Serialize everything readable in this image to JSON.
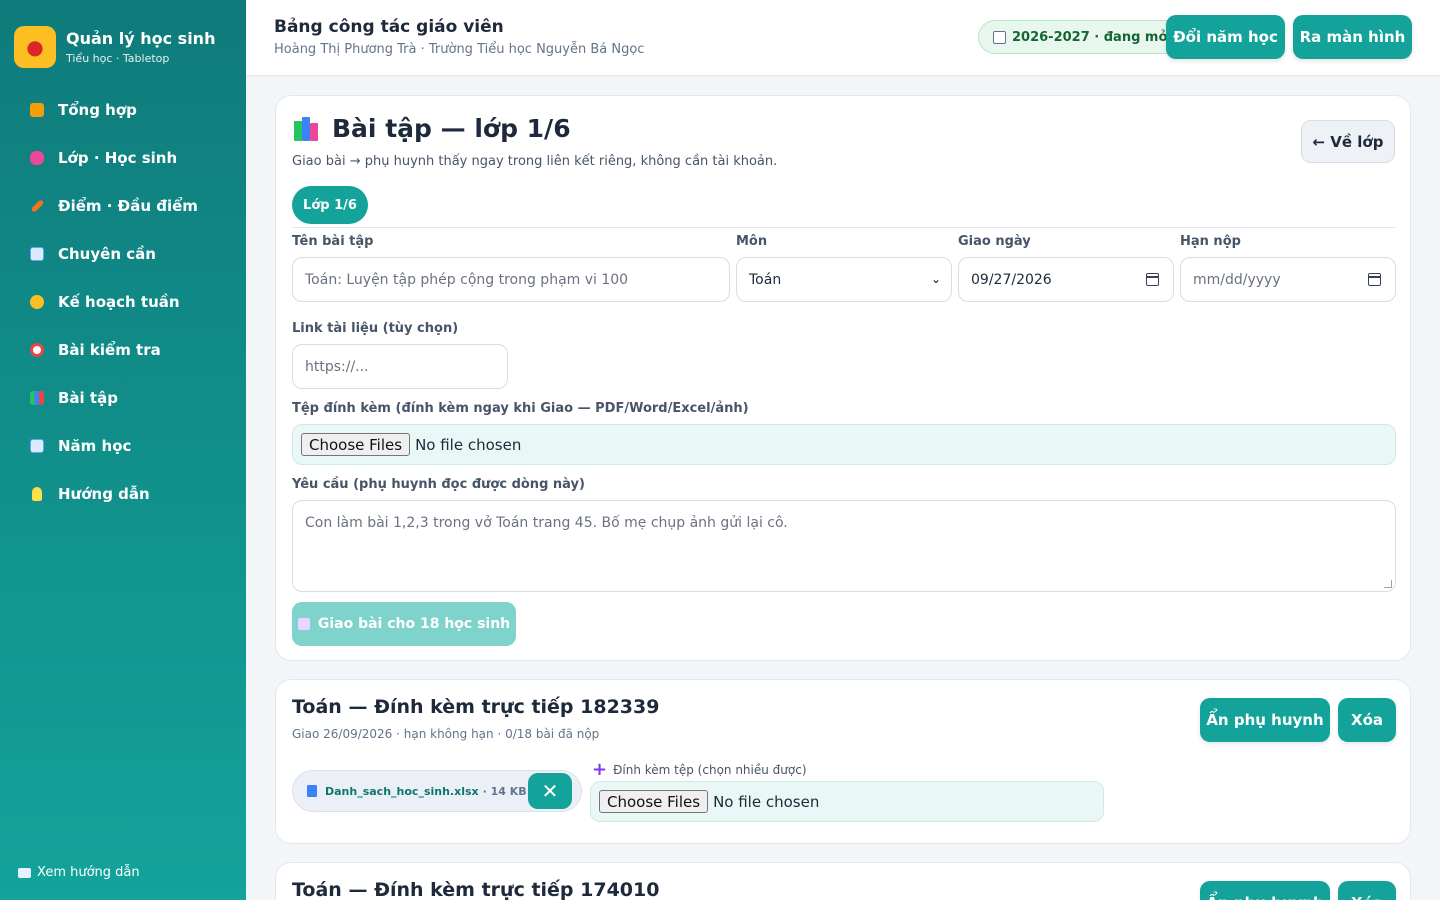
{
  "app": {
    "title": "Quản lý học sinh",
    "subtitle": "Tiểu học · Tabletop"
  },
  "sidebar": {
    "items": [
      {
        "label": "Tổng hợp",
        "icon": "house-icon",
        "color": "#f59e0b"
      },
      {
        "label": "Lớp · Học sinh",
        "icon": "backpack-icon",
        "color": "#ec4899"
      },
      {
        "label": "Điểm · Đầu điểm",
        "icon": "pencil-icon",
        "color": "#f97316"
      },
      {
        "label": "Chuyên cần",
        "icon": "calendar-icon",
        "color": "#93c5fd"
      },
      {
        "label": "Kế hoạch tuần",
        "icon": "compass-icon",
        "color": "#fbbf24"
      },
      {
        "label": "Bài kiểm tra",
        "icon": "target-icon",
        "color": "#ef4444"
      },
      {
        "label": "Bài tập",
        "icon": "books-icon",
        "color": "#22c55e"
      },
      {
        "label": "Năm học",
        "icon": "calendar-icon",
        "color": "#93c5fd"
      },
      {
        "label": "Hướng dẫn",
        "icon": "lightbulb-icon",
        "color": "#fde047"
      }
    ],
    "guide_link": "Xem hướng dẫn"
  },
  "header": {
    "title": "Bảng công tác giáo viên",
    "subtitle": "Hoàng Thị Phương Trà · Trường Tiểu học Nguyễn Bá Ngọc",
    "year_pill": "2026-2027 · đang mở",
    "change_year_btn": "Đổi năm học",
    "logout_btn": "Ra màn hình"
  },
  "assign": {
    "title": "Bài tập — lớp 1/6",
    "description": "Giao bài → phụ huynh thấy ngay trong liên kết riêng, không cần tài khoản.",
    "back_btn": "← Về lớp",
    "class_chip": "Lớp 1/6",
    "fields": {
      "name_label": "Tên bài tập",
      "name_placeholder": "Toán: Luyện tập phép cộng trong phạm vi 100",
      "subject_label": "Môn",
      "subject_value": "Toán",
      "assigned_label": "Giao ngày",
      "assigned_value": "09/27/2026",
      "due_label": "Hạn nộp",
      "due_placeholder": "mm/dd/yyyy",
      "link_label": "Link tài liệu (tùy chọn)",
      "link_placeholder": "https://...",
      "attach_label": "Tệp đính kèm (đính kèm ngay khi Giao — PDF/Word/Excel/ảnh)",
      "choose_files": "Choose Files",
      "no_file": "No file chosen",
      "request_label": "Yêu cầu (phụ huynh đọc được dòng này)",
      "request_placeholder": "Con làm bài 1,2,3 trong vở Toán trang 45. Bố mẹ chụp ảnh gửi lại cô."
    },
    "submit_btn": "Giao bài cho 18 học sinh"
  },
  "homeworks": [
    {
      "title": "Toán — Đính kèm trực tiếp 182339",
      "meta": "Giao 26/09/2026 · hạn không hạn · 0/18 bài đã nộp",
      "hide_btn": "Ẩn phụ huynh",
      "delete_btn": "Xóa",
      "file_name": "Danh_sach_hoc_sinh.xlsx",
      "file_size": "· 14 KB",
      "attach_label": "Đính kèm tệp (chọn nhiều được)",
      "choose_files": "Choose Files",
      "no_file": "No file chosen"
    },
    {
      "title": "Toán — Đính kèm trực tiếp 174010",
      "hide_btn": "Ẩn phụ huynh",
      "delete_btn": "Xóa"
    }
  ]
}
